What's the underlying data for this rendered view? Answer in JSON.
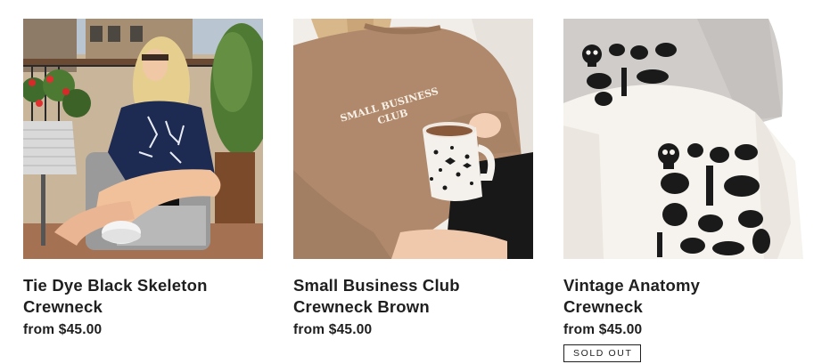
{
  "products": [
    {
      "title": "Tie Dye Black Skeleton Crewneck",
      "price": "from $45.00",
      "sold_out": false,
      "image": "photo of woman wearing navy skeleton crewneck on balcony"
    },
    {
      "title": "Small Business Club Crewneck Brown",
      "price": "from $45.00",
      "sold_out": false,
      "image": "photo of brown crewneck with mug",
      "shirt_print": [
        "SMALL BUSINESS",
        "CLUB"
      ]
    },
    {
      "title": "Vintage Anatomy Crewneck",
      "price": "from $45.00",
      "sold_out": true,
      "badge": "SOLD OUT",
      "image": "flat lay of white and grey anatomy print crewnecks"
    }
  ],
  "colors": {
    "text": "#1f1f1f",
    "background": "#ffffff"
  }
}
